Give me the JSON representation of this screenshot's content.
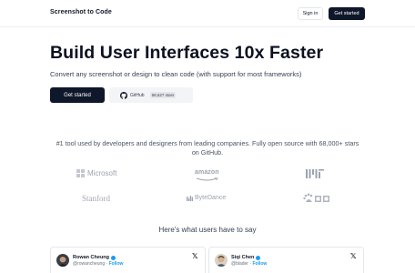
{
  "header": {
    "brand": "Screenshot to Code",
    "sign_in": "Sign in",
    "get_started": "Get started"
  },
  "hero": {
    "title": "Build User Interfaces 10x Faster",
    "subtitle": "Convert any screenshot or design to clean code (with support for most frameworks)",
    "cta": "Get started",
    "github_label": "GitHub",
    "github_stars": "68,627 stars"
  },
  "proof": {
    "text": "#1 tool used by developers and designers from leading companies. Fully open source with 68,000+ stars on GitHub.",
    "logos": {
      "microsoft": "Microsoft",
      "amazon": "amazon",
      "mit": "MIT",
      "stanford": "Stanford",
      "bytedance": "ByteDance",
      "baidu": "Baidu"
    }
  },
  "testimonials": {
    "title": "Here's what users have to say",
    "items": [
      {
        "name": "Rowan Cheung",
        "handle": "@rowancheung",
        "separator": "·",
        "follow": "Follow"
      },
      {
        "name": "Siqi Chen",
        "handle": "@blader",
        "separator": "·",
        "follow": "Follow"
      }
    ]
  },
  "colors": {
    "primary": "#0f172a",
    "logo_gray": "#9ca3af",
    "twitter_blue": "#1d9bf0"
  }
}
